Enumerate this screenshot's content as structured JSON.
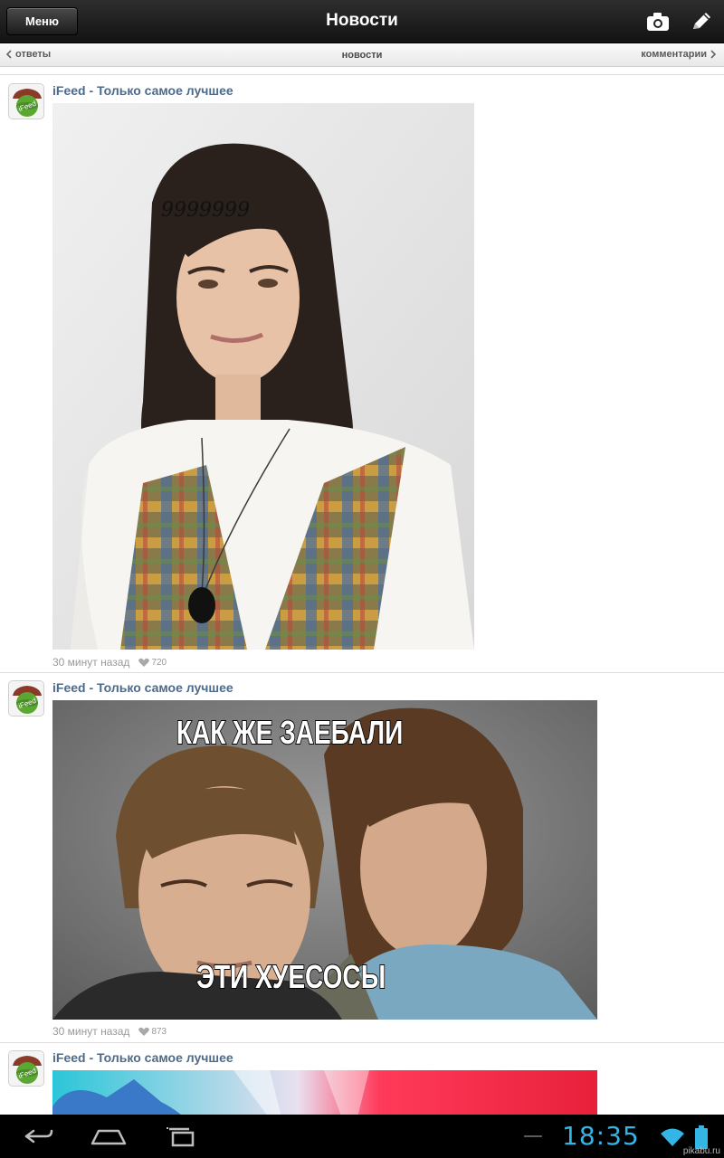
{
  "actionbar": {
    "menu_label": "Меню",
    "title": "Новости"
  },
  "subbar": {
    "left": "ответы",
    "center": "новости",
    "right": "комментарии"
  },
  "posts": [
    {
      "author": "iFeed - Только самое лучшее",
      "avatar_text": "iFeed",
      "image_caption": "9999999",
      "time": "30 минут назад",
      "likes": "720"
    },
    {
      "author": "iFeed - Только самое лучшее",
      "avatar_text": "iFeed",
      "meme_top": "КАК ЖЕ ЗАЕБАЛИ",
      "meme_bottom": "ЭТИ ХУЕСОСЫ",
      "time": "30 минут назад",
      "likes": "873"
    },
    {
      "author": "iFeed - Только самое лучшее",
      "avatar_text": "iFeed"
    }
  ],
  "statusbar": {
    "clock": "18:35",
    "battery_color": "#33b5e5"
  },
  "watermark": "pikabu.ru",
  "icons": [
    "camera-icon",
    "pencil-icon",
    "back-icon",
    "home-icon",
    "recent-apps-icon",
    "wifi-icon",
    "battery-icon",
    "heart-icon",
    "chevron-left-icon",
    "chevron-right-icon"
  ]
}
